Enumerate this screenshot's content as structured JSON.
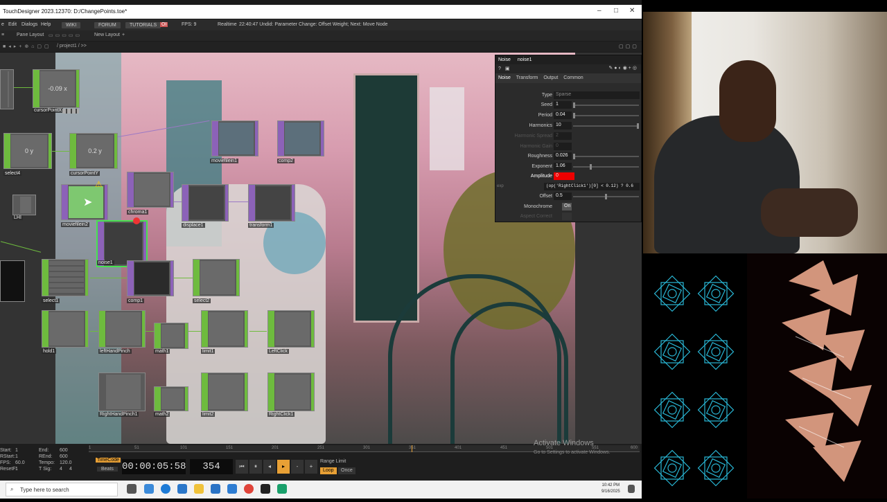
{
  "title": "TouchDesigner 2023.12370: D:/ChangePoints.toe*",
  "menu": {
    "file": "e",
    "edit": "Edit",
    "dialogs": "Dialogs",
    "help": "Help",
    "wiki": "WIKI",
    "forum": "FORUM",
    "tutorials": "TUTORIALS",
    "oi": "OI",
    "fps": "FPS:  9",
    "realtime": "Realtime",
    "status": "22:40:47 Undid: Parameter Change: Offset Weight; Next: Move Node"
  },
  "panebar": {
    "pane_layout": "Pane Layout",
    "new_layout": "New Layout"
  },
  "path": "/ project1 / >>",
  "nodes": [
    {
      "name": "cursorPointX",
      "text": "-0.09 x"
    },
    {
      "name": "select4",
      "text": "0 y"
    },
    {
      "name": "cursorPointY",
      "text": "0.2 y"
    },
    {
      "name": "moviefilein1",
      "text": ""
    },
    {
      "name": "comp2",
      "text": ""
    },
    {
      "name": "moviefilein2",
      "text": ""
    },
    {
      "name": "chroma1",
      "text": ""
    },
    {
      "name": "displace1",
      "text": ""
    },
    {
      "name": "transform1",
      "text": ""
    },
    {
      "name": "noise1",
      "text": ""
    },
    {
      "name": "select1",
      "text": ""
    },
    {
      "name": "comp1",
      "text": ""
    },
    {
      "name": "select2",
      "text": ""
    },
    {
      "name": "hold1",
      "text": ""
    },
    {
      "name": "leftHandPinch",
      "text": ""
    },
    {
      "name": "math1",
      "text": ""
    },
    {
      "name": "limit1",
      "text": ""
    },
    {
      "name": "LeftClick",
      "text": ""
    },
    {
      "name": "RightHandPinch1",
      "text": ""
    },
    {
      "name": "math2",
      "text": ""
    },
    {
      "name": "limit2",
      "text": ""
    },
    {
      "name": "RightClick1",
      "text": ""
    },
    {
      "name": "LHI",
      "text": ""
    }
  ],
  "param": {
    "op_type": "Noise",
    "op_name": "noise1",
    "tabs": [
      "Noise",
      "Transform",
      "Output",
      "Common"
    ],
    "rows": [
      {
        "label": "Type",
        "value": "Sparse"
      },
      {
        "label": "Seed",
        "value": "1"
      },
      {
        "label": "Period",
        "value": "0.04"
      },
      {
        "label": "Harmonics",
        "value": "10"
      },
      {
        "label": "Harmonic Spread",
        "value": "2"
      },
      {
        "label": "Harmonic Gain",
        "value": "0"
      },
      {
        "label": "Roughness",
        "value": "0.026"
      },
      {
        "label": "Exponent",
        "value": "1.06"
      },
      {
        "label": "Amplitude",
        "value": "0"
      },
      {
        "label": "exp",
        "value": "(op('RightClick1')[0] < 0.12) ? 0.6"
      },
      {
        "label": "Offset",
        "value": "0.5"
      },
      {
        "label": "Monochrome",
        "value": "On"
      },
      {
        "label": "Aspect Correct",
        "value": ""
      }
    ]
  },
  "timeline": {
    "start": "1",
    "end": "600",
    "rstart": "1",
    "rend": "600",
    "fps": "60.0",
    "tempo": "120.0",
    "resetf": "1",
    "tsig_a": "4",
    "tsig_b": "4",
    "labels": {
      "start": "Start:",
      "end": "End:",
      "rstart": "RStart:",
      "rend": "REnd:",
      "fps": "FPS:",
      "tempo": "Tempo:",
      "resetf": "ResetF:",
      "tsig": "T Sig:"
    },
    "ruler": [
      "1",
      "51",
      "101",
      "151",
      "201",
      "251",
      "301",
      "351",
      "401",
      "451",
      "501",
      "551",
      "600"
    ],
    "timecode_label": "TimeCode",
    "beats_label": "Beats",
    "timecode": "00:00:05:58",
    "frame": "354",
    "range_limit": "Range Limit",
    "loop": "Loop",
    "once": "Once"
  },
  "watermark": {
    "line1": "Activate Windows",
    "line2": "Go to Settings to activate Windows."
  },
  "taskbar": {
    "search_placeholder": "Type here to search",
    "time": "10:42 PM",
    "date": "9/16/2025"
  }
}
